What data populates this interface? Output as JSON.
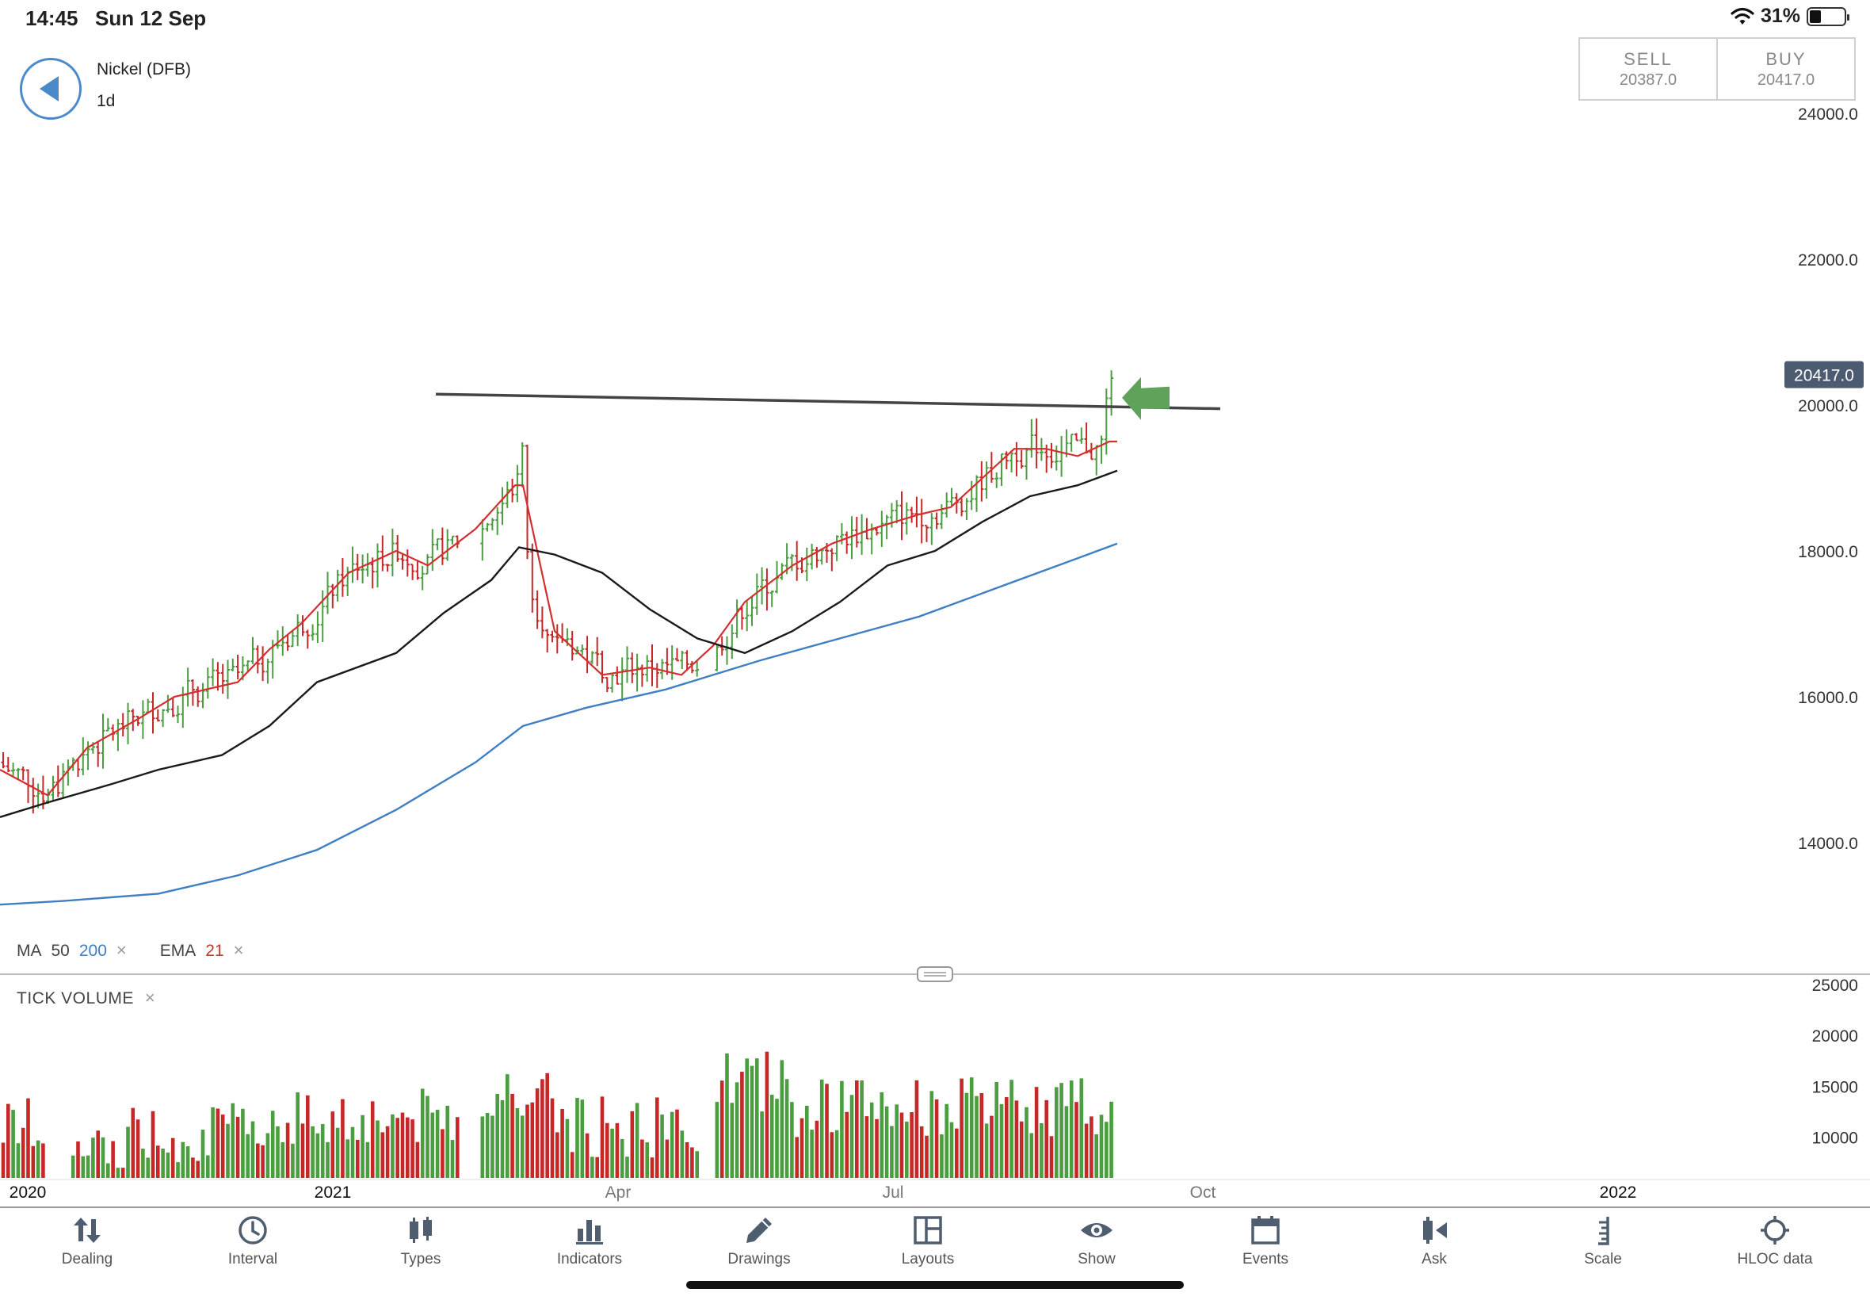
{
  "status_bar": {
    "time": "14:45",
    "date": "Sun 12 Sep",
    "battery": "31%"
  },
  "header": {
    "instrument": "Nickel (DFB)",
    "interval": "1d",
    "sell_label": "SELL",
    "sell_price": "20387.0",
    "buy_label": "BUY",
    "buy_price": "20417.0"
  },
  "colors": {
    "bull": "#4a9e3f",
    "bear": "#c62828",
    "ema": "#d32f2f",
    "ma50": "#1a1a1a",
    "ma200": "#3f7fc3",
    "price_tag": "#4d5b70",
    "arrow": "#5fa35a"
  },
  "indicators": {
    "ma_label": "MA",
    "ma_fast": "50",
    "ma_slow": "200",
    "ema_label": "EMA",
    "ema_period": "21",
    "remove_glyph": "×"
  },
  "volume_panel": {
    "title": "TICK VOLUME"
  },
  "chart_data": [
    {
      "type": "line",
      "title": "",
      "price_axis_ticks": [
        "24000.0",
        "22000.0",
        "20000.0",
        "18000.0",
        "16000.0",
        "14000.0"
      ],
      "current_price": "20417.0",
      "x_axis_ticks": [
        "2020",
        "2021",
        "Apr",
        "Jul",
        "Oct",
        "2022"
      ],
      "ylim": [
        12900,
        24350
      ],
      "series": [
        {
          "name": "EMA 21",
          "color": "#d32f2f",
          "points": [
            [
              0,
              15000
            ],
            [
              60,
              14650
            ],
            [
              110,
              15300
            ],
            [
              175,
              15700
            ],
            [
              220,
              16000
            ],
            [
              300,
              16200
            ],
            [
              340,
              16650
            ],
            [
              380,
              17000
            ],
            [
              440,
              17700
            ],
            [
              500,
              18000
            ],
            [
              540,
              17800
            ],
            [
              600,
              18300
            ],
            [
              650,
              18900
            ],
            [
              660,
              18900
            ],
            [
              700,
              16900
            ],
            [
              760,
              16300
            ],
            [
              820,
              16400
            ],
            [
              860,
              16300
            ],
            [
              900,
              16700
            ],
            [
              940,
              17300
            ],
            [
              1000,
              17800
            ],
            [
              1050,
              18100
            ],
            [
              1100,
              18300
            ],
            [
              1160,
              18500
            ],
            [
              1200,
              18600
            ],
            [
              1240,
              19000
            ],
            [
              1280,
              19400
            ],
            [
              1320,
              19400
            ],
            [
              1360,
              19300
            ],
            [
              1400,
              19500
            ],
            [
              1410,
              19500
            ]
          ]
        },
        {
          "name": "MA 50",
          "color": "#1a1a1a",
          "points": [
            [
              0,
              14350
            ],
            [
              60,
              14550
            ],
            [
              140,
              14800
            ],
            [
              200,
              15000
            ],
            [
              280,
              15200
            ],
            [
              340,
              15600
            ],
            [
              400,
              16200
            ],
            [
              500,
              16600
            ],
            [
              560,
              17150
            ],
            [
              620,
              17600
            ],
            [
              655,
              18050
            ],
            [
              700,
              17950
            ],
            [
              760,
              17700
            ],
            [
              820,
              17200
            ],
            [
              880,
              16800
            ],
            [
              940,
              16600
            ],
            [
              1000,
              16900
            ],
            [
              1060,
              17300
            ],
            [
              1120,
              17800
            ],
            [
              1180,
              18000
            ],
            [
              1240,
              18400
            ],
            [
              1300,
              18750
            ],
            [
              1360,
              18900
            ],
            [
              1410,
              19100
            ]
          ]
        },
        {
          "name": "MA 200",
          "color": "#3f7fc3",
          "points": [
            [
              0,
              13150
            ],
            [
              80,
              13200
            ],
            [
              200,
              13300
            ],
            [
              300,
              13550
            ],
            [
              400,
              13900
            ],
            [
              500,
              14450
            ],
            [
              600,
              15100
            ],
            [
              660,
              15600
            ],
            [
              740,
              15850
            ],
            [
              840,
              16100
            ],
            [
              960,
              16500
            ],
            [
              1060,
              16800
            ],
            [
              1160,
              17100
            ],
            [
              1260,
              17500
            ],
            [
              1360,
              17900
            ],
            [
              1410,
              18100
            ]
          ]
        }
      ],
      "annotations": [
        {
          "kind": "horizontal-trendline",
          "from": [
            550,
            20150
          ],
          "to": [
            1540,
            19950
          ]
        },
        {
          "kind": "arrow",
          "target_price": 20100
        }
      ]
    },
    {
      "type": "bar",
      "title": "",
      "y_axis_ticks": [
        "25000",
        "20000",
        "15000",
        "10000"
      ],
      "ylim": [
        6000,
        25000
      ]
    }
  ],
  "toolbar": [
    {
      "label": "Dealing",
      "icon": "dealing-arrows-icon"
    },
    {
      "label": "Interval",
      "icon": "clock-icon"
    },
    {
      "label": "Types",
      "icon": "candlestick-icon"
    },
    {
      "label": "Indicators",
      "icon": "bar-chart-icon"
    },
    {
      "label": "Drawings",
      "icon": "pencil-icon"
    },
    {
      "label": "Layouts",
      "icon": "layout-grid-icon"
    },
    {
      "label": "Show",
      "icon": "eye-icon"
    },
    {
      "label": "Events",
      "icon": "calendar-icon"
    },
    {
      "label": "Ask",
      "icon": "ask-candle-icon"
    },
    {
      "label": "Scale",
      "icon": "scale-icon"
    },
    {
      "label": "HLOC data",
      "icon": "crosshair-icon"
    }
  ]
}
